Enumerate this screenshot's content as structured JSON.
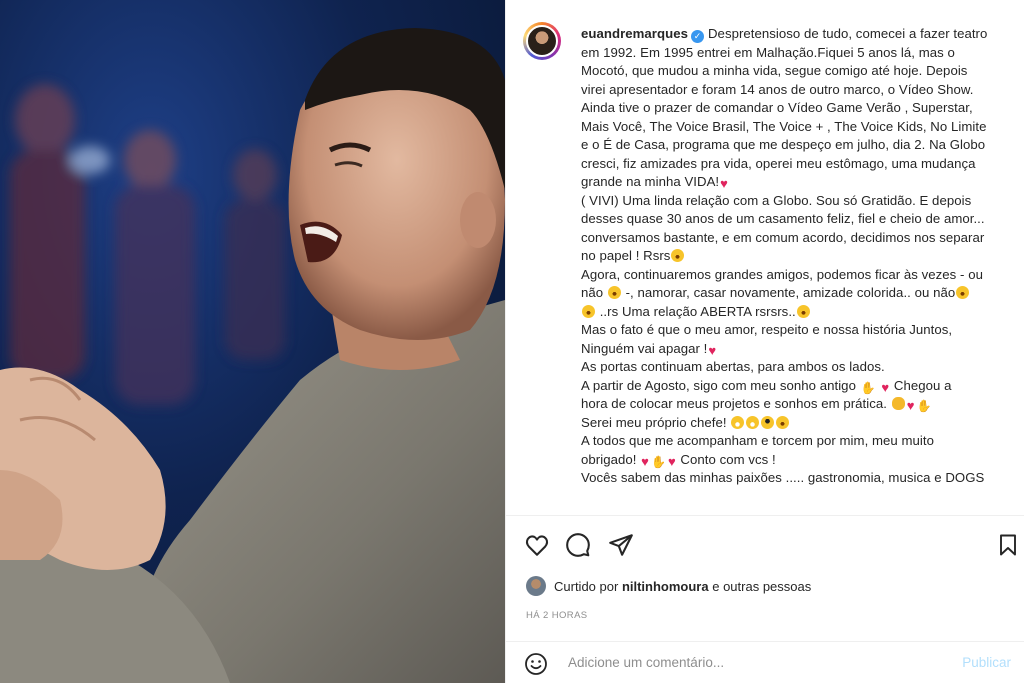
{
  "post": {
    "photo_alt": "",
    "author": {
      "username": "euandremarques",
      "verified": true
    },
    "caption_lines": [
      {
        "t": "Despretensioso de tudo, comecei a fazer teatro"
      },
      {
        "t": "em 1992. Em 1995 entrei em Malhação.Fiquei 5 anos lá, mas o"
      },
      {
        "t": "Mocotó, que mudou a minha vida, segue comigo até hoje. Depois"
      },
      {
        "t": "virei apresentador e foram 14 anos de outro marco, o Vídeo Show."
      },
      {
        "t": "Ainda tive o prazer de comandar o Vídeo Game Verão , Superstar,"
      },
      {
        "t": "Mais Você, The Voice Brasil, The Voice + , The Voice Kids, No Limite"
      },
      {
        "t": "e o É de Casa, programa que me despeço em julho, dia 2. Na Globo"
      },
      {
        "t": "cresci, fiz amizades pra vida, operei meu estômago, uma mudança"
      },
      {
        "t": "grande na minha VIDA!",
        "e": [
          "heart"
        ]
      },
      {
        "t": "( VIVI) Uma linda relação com a Globo. Sou só Gratidão. E depois"
      },
      {
        "t": "desses quase 30 anos de um casamento feliz, fiel e cheio de amor..."
      },
      {
        "t": "conversamos bastante, e em comum acordo, decidimos nos separar"
      },
      {
        "t": "no papel ! Rsrs",
        "e": [
          "laugh"
        ]
      },
      {
        "t": "Agora, continuaremos grandes amigos, podemos ficar às vezes - ou"
      },
      {
        "t": "não [e] -, namorar, casar novamente, amizade colorida.. ou não[e]",
        "inline": [
          "laugh",
          "laugh"
        ]
      },
      {
        "t": "[e] ..rs Uma relação ABERTA rsrsrs..[e]",
        "inline": [
          "laugh",
          "laugh"
        ]
      },
      {
        "t": "Mas o fato é que o meu amor, respeito e nossa história Juntos,"
      },
      {
        "t": "Ninguém vai apagar !",
        "e": [
          "heart"
        ]
      },
      {
        "t": "As portas continuam abertas, para ambos os lados."
      },
      {
        "t": "A partir de Agosto, sigo com meu sonho antigo [e] [e] Chegou a",
        "inline": [
          "pray",
          "heart"
        ]
      },
      {
        "t": "hora de colocar meus projetos e sonhos em prática. [e][e][e]",
        "inline": [
          "fist",
          "heart",
          "pray"
        ]
      },
      {
        "t": "Serei meu próprio chefe! [e][e][e][e]",
        "inline": [
          "grin",
          "grin",
          "cool",
          "laugh"
        ]
      },
      {
        "t": "A todos que me acompanham e torcem por mim, meu muito"
      },
      {
        "t": "obrigado! [e][e][e] Conto com vcs !",
        "inline": [
          "heart",
          "pray",
          "heart"
        ]
      },
      {
        "t": "Vocês sabem das minhas paixões ..... gastronomia, musica e DOGS"
      }
    ],
    "liked_by": {
      "prefix": "Curtido por",
      "user": "niltinhomoura",
      "suffix": "e outras pessoas"
    },
    "timestamp": "HÁ 2 HORAS",
    "comment": {
      "placeholder": "Adicione um comentário...",
      "publish_label": "Publicar"
    }
  },
  "icons": {
    "like": "heart-outline-icon",
    "comment": "comment-bubble-icon",
    "share": "paper-plane-icon",
    "save": "bookmark-icon",
    "emoji": "smiley-icon"
  },
  "colors": {
    "verified": "#3897f0",
    "heart": "#e0245e",
    "publish_disabled": "#b2dffc",
    "muted": "#8e8e8e"
  }
}
